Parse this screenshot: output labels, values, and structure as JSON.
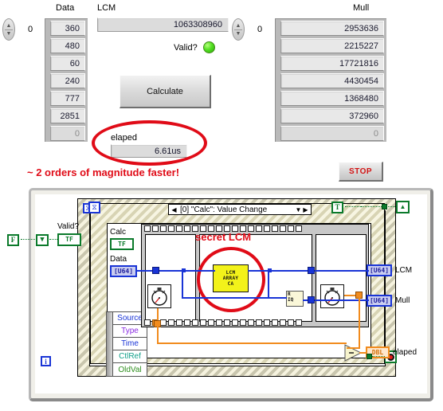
{
  "front_panel": {
    "data_array": {
      "label": "Data",
      "index_value": "0",
      "values": [
        "360",
        "480",
        "60",
        "240",
        "777",
        "2851",
        "0"
      ]
    },
    "mull_array": {
      "label": "Mull",
      "index_value": "0",
      "values": [
        "2953636",
        "2215227",
        "17721816",
        "4430454",
        "1368480",
        "372960",
        "0"
      ]
    },
    "lcm_indicator": {
      "label": "LCM",
      "value": "1063308960"
    },
    "valid_led": {
      "label": "Valid?",
      "state": "on",
      "color": "#52e021"
    },
    "calculate_button": {
      "label": "Calculate"
    },
    "elapsed_indicator": {
      "label": "elaped",
      "value": "6.61us"
    },
    "stop_button": {
      "label": "STOP"
    },
    "annotation": {
      "text": "~ 2 orders of magnitude faster!",
      "color": "#e00b17"
    }
  },
  "block_diagram": {
    "event_structure": {
      "title": "[0] \"Calc\": Value Change",
      "left_arrow": "◀",
      "right_arrow": "▶",
      "dropdown_arrow": "▼",
      "handle_glyph": "⧖"
    },
    "event_data_node": {
      "rows": [
        {
          "label": "Source",
          "color": "#1934d6"
        },
        {
          "label": "Type",
          "color": "#8a2be2"
        },
        {
          "label": "Time",
          "color": "#1934d6"
        },
        {
          "label": "CtlRef",
          "color": "#13a08a"
        },
        {
          "label": "OldVal",
          "color": "#2f8f1f"
        }
      ]
    },
    "controls": [
      {
        "name": "calc-terminal",
        "label": "Calc",
        "type": "TF"
      },
      {
        "name": "data-terminal",
        "label": "Data",
        "type": "[U64]"
      }
    ],
    "indicators": [
      {
        "name": "lcm-terminal",
        "label": "LCM",
        "type": "[U64]"
      },
      {
        "name": "mull-terminal",
        "label": "Mull",
        "type": "[U64]"
      },
      {
        "name": "elapsed-terminal",
        "label": "elaped",
        "type": "DBL"
      }
    ],
    "valid_terminal": {
      "label": "Valid?",
      "type": "TF"
    },
    "false_constant": {
      "label": "F"
    },
    "true_constant": {
      "label": "T"
    },
    "subvi": {
      "line1": "LCM",
      "line2": "ARRAY",
      "line3": "CA"
    },
    "quotient_node": {
      "line1": "R",
      "line2": "IQ"
    },
    "annotation": {
      "text": "secret LCM",
      "color": "#e00b17"
    },
    "loop_iterator": {
      "label": "i"
    },
    "loop_timeout": {
      "glyph": "⧖"
    }
  }
}
